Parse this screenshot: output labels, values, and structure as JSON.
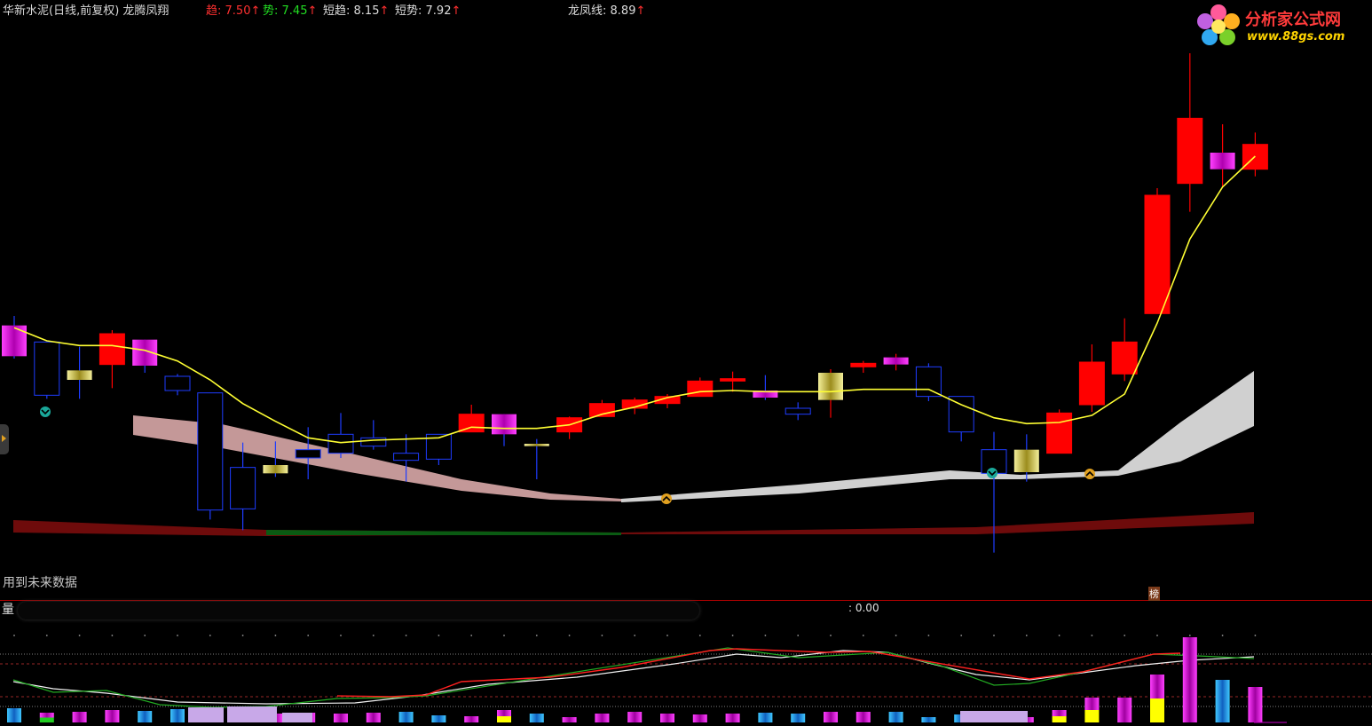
{
  "header": {
    "stock_label": "华新水泥(日线,前复权) 龙腾凤翔",
    "items": [
      {
        "label": "趋: ",
        "value": "7.50",
        "arrow": "↑",
        "color": "#ff3030"
      },
      {
        "label": "势: ",
        "value": "7.45",
        "arrow": "↑",
        "color": "#22dd22"
      },
      {
        "label": "短趋: ",
        "value": "8.15",
        "arrow": "↑",
        "color": "#dddddd"
      },
      {
        "label": "短势: ",
        "value": "7.92",
        "arrow": "↑",
        "color": "#dddddd"
      },
      {
        "label": "龙凤线: ",
        "value": "8.89",
        "arrow": "↑",
        "color": "#dddddd"
      }
    ]
  },
  "watermark": {
    "name": "分析家公式网",
    "url": "www.88gs.com"
  },
  "notice": "用到未来数据",
  "marker_text": "榜",
  "volume_panel": {
    "title": "量",
    "readout": ": 0.00"
  },
  "colors": {
    "up": "#ff0000",
    "down": "#1e3cff",
    "ma": "#ffff33",
    "magenta": "#ff00ff",
    "gold": "#d4c24a"
  },
  "chart_data": {
    "type": "candlestick",
    "price_range": [
      5.6,
      10.4
    ],
    "candles": [
      {
        "o": 7.8,
        "h": 7.88,
        "l": 7.52,
        "c": 7.54,
        "style": "magenta"
      },
      {
        "o": 7.66,
        "h": 7.66,
        "l": 7.18,
        "c": 7.21,
        "style": "down"
      },
      {
        "o": 7.42,
        "h": 7.62,
        "l": 7.18,
        "c": 7.34,
        "style": "gold"
      },
      {
        "o": 7.47,
        "h": 7.76,
        "l": 7.27,
        "c": 7.73,
        "style": "up"
      },
      {
        "o": 7.68,
        "h": 7.68,
        "l": 7.4,
        "c": 7.46,
        "style": "magenta"
      },
      {
        "o": 7.25,
        "h": 7.39,
        "l": 7.21,
        "c": 7.37,
        "style": "down"
      },
      {
        "o": 7.23,
        "h": 7.23,
        "l": 6.16,
        "c": 6.24,
        "style": "down"
      },
      {
        "o": 6.6,
        "h": 6.81,
        "l": 6.07,
        "c": 6.25,
        "style": "down"
      },
      {
        "o": 6.62,
        "h": 6.82,
        "l": 6.52,
        "c": 6.55,
        "style": "gold"
      },
      {
        "o": 6.75,
        "h": 6.94,
        "l": 6.5,
        "c": 6.68,
        "style": "down"
      },
      {
        "o": 6.88,
        "h": 7.06,
        "l": 6.68,
        "c": 6.72,
        "style": "down"
      },
      {
        "o": 6.85,
        "h": 7.0,
        "l": 6.75,
        "c": 6.78,
        "style": "down"
      },
      {
        "o": 6.72,
        "h": 6.88,
        "l": 6.48,
        "c": 6.66,
        "style": "down"
      },
      {
        "o": 6.88,
        "h": 6.88,
        "l": 6.62,
        "c": 6.67,
        "style": "down"
      },
      {
        "o": 6.9,
        "h": 7.13,
        "l": 6.9,
        "c": 7.05,
        "style": "up"
      },
      {
        "o": 7.05,
        "h": 7.05,
        "l": 6.78,
        "c": 6.88,
        "style": "magenta"
      },
      {
        "o": 6.8,
        "h": 6.84,
        "l": 6.5,
        "c": 6.78,
        "style": "gold"
      },
      {
        "o": 6.9,
        "h": 7.03,
        "l": 6.84,
        "c": 7.02,
        "style": "up"
      },
      {
        "o": 7.03,
        "h": 7.17,
        "l": 7.03,
        "c": 7.14,
        "style": "up"
      },
      {
        "o": 7.1,
        "h": 7.19,
        "l": 7.05,
        "c": 7.17,
        "style": "up"
      },
      {
        "o": 7.14,
        "h": 7.22,
        "l": 7.1,
        "c": 7.2,
        "style": "up"
      },
      {
        "o": 7.2,
        "h": 7.36,
        "l": 7.2,
        "c": 7.33,
        "style": "up"
      },
      {
        "o": 7.33,
        "h": 7.41,
        "l": 7.24,
        "c": 7.35,
        "style": "up"
      },
      {
        "o": 7.25,
        "h": 7.38,
        "l": 7.17,
        "c": 7.19,
        "style": "magenta"
      },
      {
        "o": 7.05,
        "h": 7.15,
        "l": 7.0,
        "c": 7.1,
        "style": "down"
      },
      {
        "o": 7.17,
        "h": 7.43,
        "l": 7.02,
        "c": 7.4,
        "style": "gold"
      },
      {
        "o": 7.45,
        "h": 7.5,
        "l": 7.4,
        "c": 7.48,
        "style": "up"
      },
      {
        "o": 7.47,
        "h": 7.56,
        "l": 7.42,
        "c": 7.53,
        "style": "magenta"
      },
      {
        "o": 7.2,
        "h": 7.48,
        "l": 7.16,
        "c": 7.45,
        "style": "down"
      },
      {
        "o": 6.9,
        "h": 7.2,
        "l": 6.82,
        "c": 7.2,
        "style": "down"
      },
      {
        "o": 6.55,
        "h": 6.9,
        "l": 5.88,
        "c": 6.75,
        "style": "down"
      },
      {
        "o": 6.75,
        "h": 6.88,
        "l": 6.48,
        "c": 6.56,
        "style": "gold"
      },
      {
        "o": 6.72,
        "h": 7.09,
        "l": 6.72,
        "c": 7.06,
        "style": "up"
      },
      {
        "o": 7.13,
        "h": 7.64,
        "l": 7.07,
        "c": 7.49,
        "style": "up"
      },
      {
        "o": 7.39,
        "h": 7.86,
        "l": 7.33,
        "c": 7.66,
        "style": "up"
      },
      {
        "o": 7.9,
        "h": 8.96,
        "l": 7.9,
        "c": 8.9,
        "style": "up"
      },
      {
        "o": 9.0,
        "h": 10.1,
        "l": 8.76,
        "c": 9.55,
        "style": "up"
      },
      {
        "o": 9.12,
        "h": 9.5,
        "l": 8.97,
        "c": 9.26,
        "style": "magenta"
      },
      {
        "o": 9.12,
        "h": 9.43,
        "l": 9.06,
        "c": 9.33,
        "style": "up"
      }
    ],
    "ma_line": [
      7.78,
      7.67,
      7.63,
      7.63,
      7.59,
      7.5,
      7.34,
      7.14,
      6.99,
      6.85,
      6.81,
      6.83,
      6.84,
      6.85,
      6.94,
      6.93,
      6.93,
      6.96,
      7.05,
      7.11,
      7.19,
      7.24,
      7.25,
      7.24,
      7.24,
      7.24,
      7.26,
      7.26,
      7.26,
      7.13,
      7.02,
      6.97,
      6.98,
      7.04,
      7.22,
      7.82,
      8.53,
      8.97,
      9.23
    ],
    "volume": [
      {
        "v": 0.8,
        "style": "cyan"
      },
      {
        "v": 0.55,
        "style": "mix"
      },
      {
        "v": 0.6,
        "style": "magenta"
      },
      {
        "v": 0.7,
        "style": "magenta"
      },
      {
        "v": 0.65,
        "style": "cyan"
      },
      {
        "v": 0.75,
        "style": "cyan"
      },
      {
        "v": 0.8,
        "style": "cyan"
      },
      {
        "v": 0.6,
        "style": "magenta"
      },
      {
        "v": 0.5,
        "style": "magenta"
      },
      {
        "v": 0.55,
        "style": "magenta"
      },
      {
        "v": 0.5,
        "style": "magenta"
      },
      {
        "v": 0.55,
        "style": "magenta"
      },
      {
        "v": 0.6,
        "style": "cyan"
      },
      {
        "v": 0.4,
        "style": "cyan"
      },
      {
        "v": 0.35,
        "style": "magenta"
      },
      {
        "v": 0.7,
        "style": "mixy"
      },
      {
        "v": 0.5,
        "style": "cyan"
      },
      {
        "v": 0.3,
        "style": "magenta"
      },
      {
        "v": 0.5,
        "style": "magenta"
      },
      {
        "v": 0.6,
        "style": "magenta"
      },
      {
        "v": 0.5,
        "style": "magenta"
      },
      {
        "v": 0.45,
        "style": "magenta"
      },
      {
        "v": 0.5,
        "style": "magenta"
      },
      {
        "v": 0.55,
        "style": "cyan"
      },
      {
        "v": 0.5,
        "style": "cyan"
      },
      {
        "v": 0.6,
        "style": "magenta"
      },
      {
        "v": 0.6,
        "style": "magenta"
      },
      {
        "v": 0.6,
        "style": "cyan"
      },
      {
        "v": 0.3,
        "style": "cyan"
      },
      {
        "v": 0.45,
        "style": "cyan"
      },
      {
        "v": 0.5,
        "style": "cyan"
      },
      {
        "v": 0.3,
        "style": "magenta"
      },
      {
        "v": 0.7,
        "style": "mixy"
      },
      {
        "v": 1.4,
        "style": "mixy"
      },
      {
        "v": 1.4,
        "style": "magenta"
      },
      {
        "v": 2.7,
        "style": "mixy"
      },
      {
        "v": 4.8,
        "style": "magenta"
      },
      {
        "v": 2.4,
        "style": "cyan"
      },
      {
        "v": 2.0,
        "style": "magenta"
      }
    ]
  }
}
